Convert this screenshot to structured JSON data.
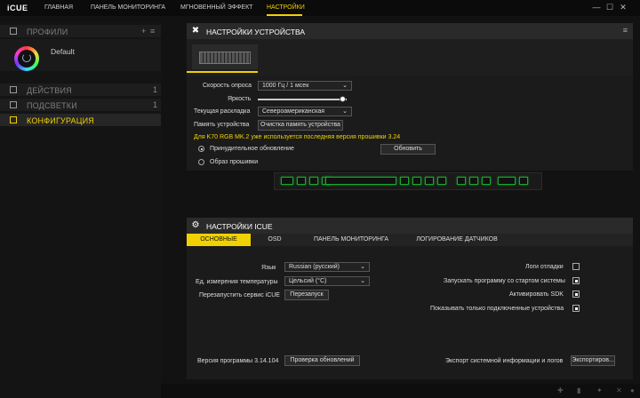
{
  "app": {
    "brand": "iCUE"
  },
  "nav": {
    "items": [
      "ГЛАВНАЯ",
      "ПАНЕЛЬ МОНИТОРИНГА",
      "МГНОВЕННЫЙ ЭФФЕКТ",
      "НАСТРОЙКИ"
    ],
    "active": 3
  },
  "window": {
    "minimize": "—",
    "maximize": "☐",
    "close": "✕"
  },
  "sidebar": {
    "profiles": {
      "title": "ПРОФИЛИ",
      "add": "+",
      "menu": "≡"
    },
    "profile": {
      "name": "Default"
    },
    "actions": {
      "title": "ДЕЙСТВИЯ",
      "count": "1"
    },
    "lighting": {
      "title": "ПОДСВЕТКИ",
      "count": "1"
    },
    "config": {
      "title": "КОНФИГУРАЦИЯ"
    }
  },
  "device": {
    "title": "НАСТРОЙКИ УСТРОЙСТВА",
    "polling_label": "Скорость опроса",
    "polling_value": "1000 Гц / 1 мсек",
    "brightness_label": "Яркость",
    "brightness": 0.96,
    "layout_label": "Текущая раскладка",
    "layout_value": "Североамериканская",
    "memory_label": "Память устройства",
    "memory_button": "Очистка память устройства",
    "firmware_notice": "Для K70 RGB MK.2 уже используется последняя версия прошивки 3.24",
    "force_update_label": "Принудительное обновление",
    "update_button": "Обновить",
    "firmware_image_label": "Образ прошивки"
  },
  "icue": {
    "title": "НАСТРОЙКИ ICUE",
    "tabs": [
      "ОСНОВНЫЕ",
      "OSD",
      "ПАНЕЛЬ МОНИТОРИНГА",
      "ЛОГИРОВАНИЕ ДАТЧИКОВ"
    ],
    "language_label": "Язык",
    "language_value": "Russian (русский)",
    "temp_label": "Ед. измерения температуры",
    "temp_value": "Цельсий (°C)",
    "restart_label": "Перезапустить сервис iCUE",
    "restart_button": "Перезапуск",
    "debug_logs_label": "Логи отладки",
    "debug_logs": false,
    "startup_label": "Запускать программу со стартом системы",
    "startup": true,
    "sdk_label": "Активировать SDK",
    "sdk": true,
    "connected_label": "Показывать только подключенные устройства",
    "connected": true,
    "version_label": "Версия программы 3.14.104",
    "check_updates_button": "Проверка обновлений",
    "export_label": "Экспорт системной информации и логов",
    "export_button": "Экспортиров..."
  },
  "colors": {
    "accent": "#f2d100",
    "key_glow": "#1aa52d"
  }
}
